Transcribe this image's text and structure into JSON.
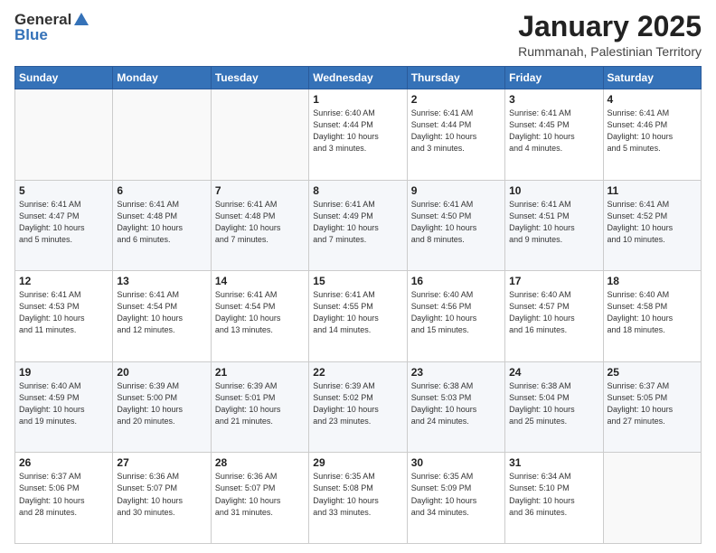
{
  "header": {
    "logo_general": "General",
    "logo_blue": "Blue",
    "month": "January 2025",
    "location": "Rummanah, Palestinian Territory"
  },
  "weekdays": [
    "Sunday",
    "Monday",
    "Tuesday",
    "Wednesday",
    "Thursday",
    "Friday",
    "Saturday"
  ],
  "weeks": [
    [
      {
        "day": "",
        "info": ""
      },
      {
        "day": "",
        "info": ""
      },
      {
        "day": "",
        "info": ""
      },
      {
        "day": "1",
        "info": "Sunrise: 6:40 AM\nSunset: 4:44 PM\nDaylight: 10 hours\nand 3 minutes."
      },
      {
        "day": "2",
        "info": "Sunrise: 6:41 AM\nSunset: 4:44 PM\nDaylight: 10 hours\nand 3 minutes."
      },
      {
        "day": "3",
        "info": "Sunrise: 6:41 AM\nSunset: 4:45 PM\nDaylight: 10 hours\nand 4 minutes."
      },
      {
        "day": "4",
        "info": "Sunrise: 6:41 AM\nSunset: 4:46 PM\nDaylight: 10 hours\nand 5 minutes."
      }
    ],
    [
      {
        "day": "5",
        "info": "Sunrise: 6:41 AM\nSunset: 4:47 PM\nDaylight: 10 hours\nand 5 minutes."
      },
      {
        "day": "6",
        "info": "Sunrise: 6:41 AM\nSunset: 4:48 PM\nDaylight: 10 hours\nand 6 minutes."
      },
      {
        "day": "7",
        "info": "Sunrise: 6:41 AM\nSunset: 4:48 PM\nDaylight: 10 hours\nand 7 minutes."
      },
      {
        "day": "8",
        "info": "Sunrise: 6:41 AM\nSunset: 4:49 PM\nDaylight: 10 hours\nand 7 minutes."
      },
      {
        "day": "9",
        "info": "Sunrise: 6:41 AM\nSunset: 4:50 PM\nDaylight: 10 hours\nand 8 minutes."
      },
      {
        "day": "10",
        "info": "Sunrise: 6:41 AM\nSunset: 4:51 PM\nDaylight: 10 hours\nand 9 minutes."
      },
      {
        "day": "11",
        "info": "Sunrise: 6:41 AM\nSunset: 4:52 PM\nDaylight: 10 hours\nand 10 minutes."
      }
    ],
    [
      {
        "day": "12",
        "info": "Sunrise: 6:41 AM\nSunset: 4:53 PM\nDaylight: 10 hours\nand 11 minutes."
      },
      {
        "day": "13",
        "info": "Sunrise: 6:41 AM\nSunset: 4:54 PM\nDaylight: 10 hours\nand 12 minutes."
      },
      {
        "day": "14",
        "info": "Sunrise: 6:41 AM\nSunset: 4:54 PM\nDaylight: 10 hours\nand 13 minutes."
      },
      {
        "day": "15",
        "info": "Sunrise: 6:41 AM\nSunset: 4:55 PM\nDaylight: 10 hours\nand 14 minutes."
      },
      {
        "day": "16",
        "info": "Sunrise: 6:40 AM\nSunset: 4:56 PM\nDaylight: 10 hours\nand 15 minutes."
      },
      {
        "day": "17",
        "info": "Sunrise: 6:40 AM\nSunset: 4:57 PM\nDaylight: 10 hours\nand 16 minutes."
      },
      {
        "day": "18",
        "info": "Sunrise: 6:40 AM\nSunset: 4:58 PM\nDaylight: 10 hours\nand 18 minutes."
      }
    ],
    [
      {
        "day": "19",
        "info": "Sunrise: 6:40 AM\nSunset: 4:59 PM\nDaylight: 10 hours\nand 19 minutes."
      },
      {
        "day": "20",
        "info": "Sunrise: 6:39 AM\nSunset: 5:00 PM\nDaylight: 10 hours\nand 20 minutes."
      },
      {
        "day": "21",
        "info": "Sunrise: 6:39 AM\nSunset: 5:01 PM\nDaylight: 10 hours\nand 21 minutes."
      },
      {
        "day": "22",
        "info": "Sunrise: 6:39 AM\nSunset: 5:02 PM\nDaylight: 10 hours\nand 23 minutes."
      },
      {
        "day": "23",
        "info": "Sunrise: 6:38 AM\nSunset: 5:03 PM\nDaylight: 10 hours\nand 24 minutes."
      },
      {
        "day": "24",
        "info": "Sunrise: 6:38 AM\nSunset: 5:04 PM\nDaylight: 10 hours\nand 25 minutes."
      },
      {
        "day": "25",
        "info": "Sunrise: 6:37 AM\nSunset: 5:05 PM\nDaylight: 10 hours\nand 27 minutes."
      }
    ],
    [
      {
        "day": "26",
        "info": "Sunrise: 6:37 AM\nSunset: 5:06 PM\nDaylight: 10 hours\nand 28 minutes."
      },
      {
        "day": "27",
        "info": "Sunrise: 6:36 AM\nSunset: 5:07 PM\nDaylight: 10 hours\nand 30 minutes."
      },
      {
        "day": "28",
        "info": "Sunrise: 6:36 AM\nSunset: 5:07 PM\nDaylight: 10 hours\nand 31 minutes."
      },
      {
        "day": "29",
        "info": "Sunrise: 6:35 AM\nSunset: 5:08 PM\nDaylight: 10 hours\nand 33 minutes."
      },
      {
        "day": "30",
        "info": "Sunrise: 6:35 AM\nSunset: 5:09 PM\nDaylight: 10 hours\nand 34 minutes."
      },
      {
        "day": "31",
        "info": "Sunrise: 6:34 AM\nSunset: 5:10 PM\nDaylight: 10 hours\nand 36 minutes."
      },
      {
        "day": "",
        "info": ""
      }
    ]
  ]
}
